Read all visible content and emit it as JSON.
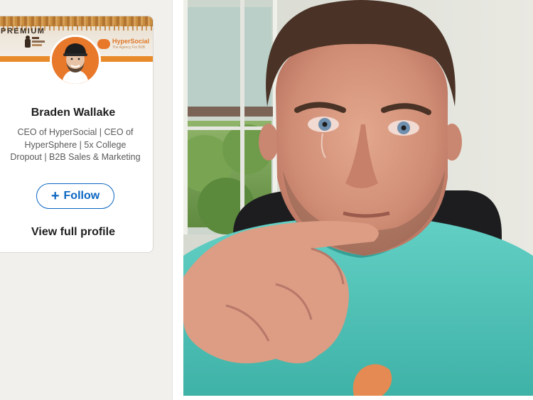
{
  "profile_card": {
    "banner_label": "PREMIUM",
    "banner_brand": "HyperSocial",
    "banner_tagline": "The Agency For B2B",
    "name": "Braden Wallake",
    "headline": "CEO of HyperSocial | CEO of HyperSphere | 5x College Dropout | B2B Sales & Marketing",
    "follow_label": "Follow",
    "view_profile_label": "View full profile"
  },
  "photo": {
    "subject": "man crying in teal t-shirt"
  },
  "colors": {
    "accent_orange": "#e8782a",
    "link_blue": "#0a66c2",
    "shirt_teal": "#52c4b9"
  },
  "icons": [
    "plus-icon",
    "speech-bubble-icon"
  ]
}
